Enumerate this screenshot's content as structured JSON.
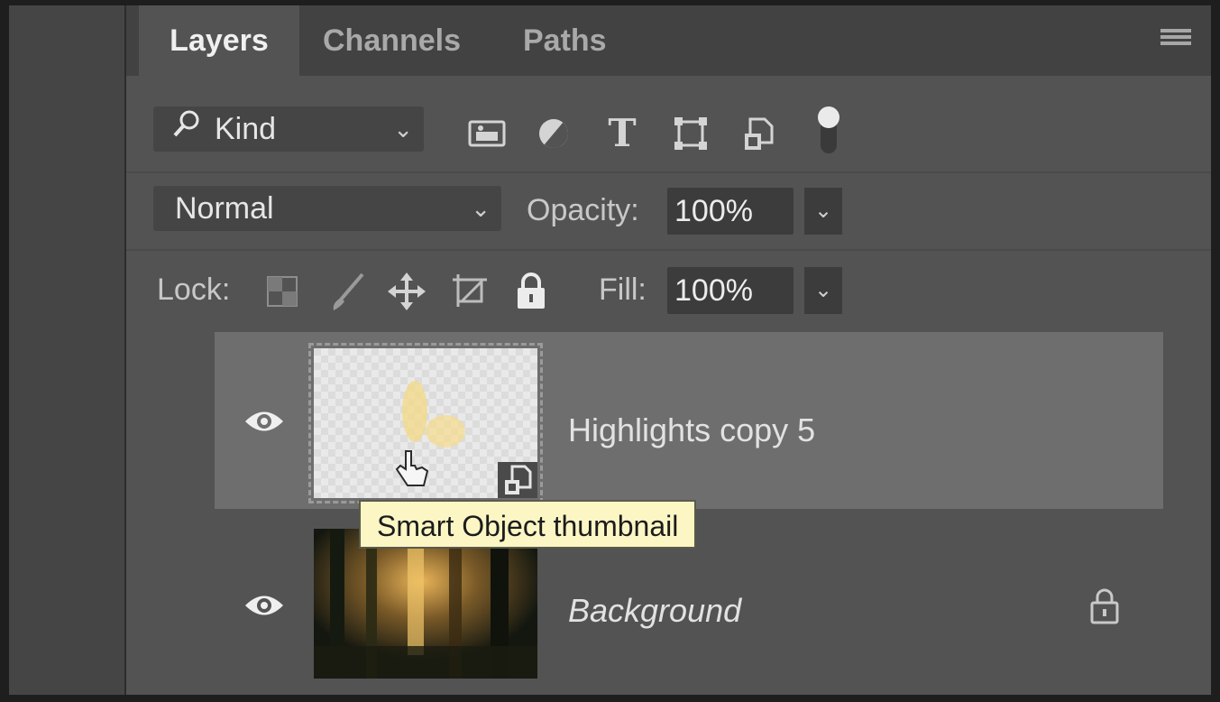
{
  "tabs": [
    {
      "label": "Layers",
      "active": true
    },
    {
      "label": "Channels",
      "active": false
    },
    {
      "label": "Paths",
      "active": false
    }
  ],
  "filter": {
    "kind_label": "Kind",
    "icons": [
      "image-filter-icon",
      "adjustment-filter-icon",
      "type-filter-icon",
      "shape-filter-icon",
      "smart-object-filter-icon",
      "filter-toggle-icon"
    ]
  },
  "blend": {
    "mode": "Normal",
    "opacity_label": "Opacity:",
    "opacity_value": "100%"
  },
  "lock": {
    "label": "Lock:",
    "icons": [
      "lock-transparent-pixels-icon",
      "lock-image-pixels-icon",
      "lock-position-icon",
      "lock-artboard-icon",
      "lock-all-icon"
    ],
    "fill_label": "Fill:",
    "fill_value": "100%"
  },
  "layers": [
    {
      "name": "Highlights copy 5",
      "visible": true,
      "selected": true,
      "type": "smart-object"
    },
    {
      "name": "Background",
      "visible": true,
      "selected": false,
      "locked": true
    }
  ],
  "tooltip": "Smart Object thumbnail",
  "colors": {
    "panel_bg": "#535353",
    "selected_layer_bg": "#6e6e6e",
    "tooltip_bg": "#fbf6c4"
  }
}
